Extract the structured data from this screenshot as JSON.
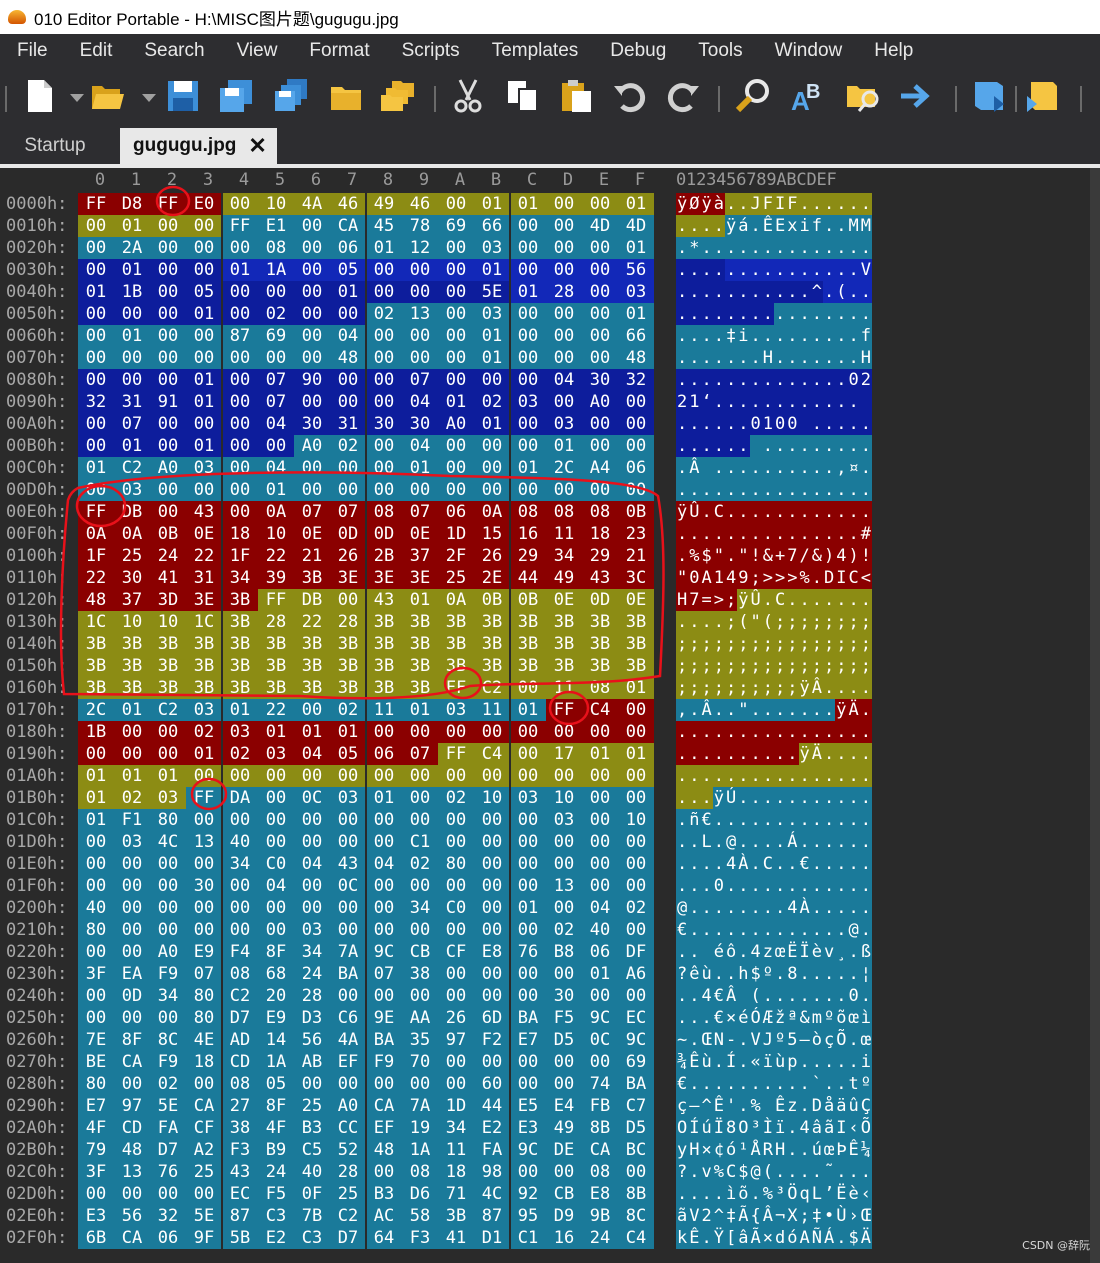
{
  "title_bar": {
    "title": "010 Editor Portable - H:\\MISC图片题\\gugugu.jpg"
  },
  "menu": [
    "File",
    "Edit",
    "Search",
    "View",
    "Format",
    "Scripts",
    "Templates",
    "Debug",
    "Tools",
    "Window",
    "Help"
  ],
  "toolbar": {
    "icons": [
      "new-file-icon",
      "open-file-icon",
      "save-icon",
      "save-as-icon",
      "save-all-icon",
      "open-folder-icon",
      "multi-folder-icon",
      "cut-icon",
      "copy-icon",
      "paste-icon",
      "undo-icon",
      "redo-icon",
      "find-icon",
      "replace-icon",
      "find-in-files-icon",
      "goto-icon",
      "run-script-icon",
      "run-template-icon"
    ]
  },
  "tabs": {
    "startup": "Startup",
    "active": "gugugu.jpg",
    "close": "✕"
  },
  "hex": {
    "columns": [
      "0",
      "1",
      "2",
      "3",
      "4",
      "5",
      "6",
      "7",
      "8",
      "9",
      "A",
      "B",
      "C",
      "D",
      "E",
      "F"
    ],
    "ascii_header": "0123456789ABCDEF",
    "colors": {
      "dark_red": "#8b0000",
      "olive": "#8c8c14",
      "teal": "#1a7a9a",
      "navy": "#0d1d9c",
      "bright_navy": "#1228b8",
      "marker": "#e8111a"
    },
    "rows": [
      {
        "addr": "0000h:",
        "bytes": "FF D8 FF E0 00 10 4A 46 49 46 00 01 01 00 00 01",
        "ascii": "ÿØÿà..JFIF......"
      },
      {
        "addr": "0010h:",
        "bytes": "00 01 00 00 FF E1 00 CA 45 78 69 66 00 00 4D 4D",
        "ascii": "....ÿá.ÊExif..MM"
      },
      {
        "addr": "0020h:",
        "bytes": "00 2A 00 00 00 08 00 06 01 12 00 03 00 00 00 01",
        "ascii": ".*.............."
      },
      {
        "addr": "0030h:",
        "bytes": "00 01 00 00 01 1A 00 05 00 00 00 01 00 00 00 56",
        "ascii": "...............V"
      },
      {
        "addr": "0040h:",
        "bytes": "01 1B 00 05 00 00 00 01 00 00 00 5E 01 28 00 03",
        "ascii": "...........^.(.."
      },
      {
        "addr": "0050h:",
        "bytes": "00 00 00 01 00 02 00 00 02 13 00 03 00 00 00 01",
        "ascii": "................"
      },
      {
        "addr": "0060h:",
        "bytes": "00 01 00 00 87 69 00 04 00 00 00 01 00 00 00 66",
        "ascii": "....‡i.........f"
      },
      {
        "addr": "0070h:",
        "bytes": "00 00 00 00 00 00 00 48 00 00 00 01 00 00 00 48",
        "ascii": ".......H.......H"
      },
      {
        "addr": "0080h:",
        "bytes": "00 00 00 01 00 07 90 00 00 07 00 00 00 04 30 32",
        "ascii": "..............02"
      },
      {
        "addr": "0090h:",
        "bytes": "32 31 91 01 00 07 00 00 00 04 01 02 03 00 A0 00",
        "ascii": "21‘............ "
      },
      {
        "addr": "00A0h:",
        "bytes": "00 07 00 00 00 04 30 31 30 30 A0 01 00 03 00 00",
        "ascii": "......0100 ....."
      },
      {
        "addr": "00B0h:",
        "bytes": "00 01 00 01 00 00 A0 02 00 04 00 00 00 01 00 00",
        "ascii": "...... ........."
      },
      {
        "addr": "00C0h:",
        "bytes": "01 C2 A0 03 00 04 00 00 00 01 00 00 01 2C A4 06",
        "ascii": ".Â ..........,¤."
      },
      {
        "addr": "00D0h:",
        "bytes": "00 03 00 00 00 01 00 00 00 00 00 00 00 00 00 00",
        "ascii": "................"
      },
      {
        "addr": "00E0h:",
        "bytes": "FF DB 00 43 00 0A 07 07 08 07 06 0A 08 08 08 0B",
        "ascii": "ÿÛ.C............"
      },
      {
        "addr": "00F0h:",
        "bytes": "0A 0A 0B 0E 18 10 0E 0D 0D 0E 1D 15 16 11 18 23",
        "ascii": "...............#"
      },
      {
        "addr": "0100h:",
        "bytes": "1F 25 24 22 1F 22 21 26 2B 37 2F 26 29 34 29 21",
        "ascii": ".%$\".\"!&+7/&)4)!"
      },
      {
        "addr": "0110h:",
        "bytes": "22 30 41 31 34 39 3B 3E 3E 3E 25 2E 44 49 43 3C",
        "ascii": "\"0A149;>>>%.DIC<"
      },
      {
        "addr": "0120h:",
        "bytes": "48 37 3D 3E 3B FF DB 00 43 01 0A 0B 0B 0E 0D 0E",
        "ascii": "H7=>;ÿÛ.C......."
      },
      {
        "addr": "0130h:",
        "bytes": "1C 10 10 1C 3B 28 22 28 3B 3B 3B 3B 3B 3B 3B 3B",
        "ascii": "....;(\"(;;;;;;;;"
      },
      {
        "addr": "0140h:",
        "bytes": "3B 3B 3B 3B 3B 3B 3B 3B 3B 3B 3B 3B 3B 3B 3B 3B",
        "ascii": ";;;;;;;;;;;;;;;;"
      },
      {
        "addr": "0150h:",
        "bytes": "3B 3B 3B 3B 3B 3B 3B 3B 3B 3B 3B 3B 3B 3B 3B 3B",
        "ascii": ";;;;;;;;;;;;;;;;"
      },
      {
        "addr": "0160h:",
        "bytes": "3B 3B 3B 3B 3B 3B 3B 3B 3B 3B FF C2 00 11 08 01",
        "ascii": ";;;;;;;;;;ÿÂ...."
      },
      {
        "addr": "0170h:",
        "bytes": "2C 01 C2 03 01 22 00 02 11 01 03 11 01 FF C4 00",
        "ascii": ",.Â..\".......ÿÄ."
      },
      {
        "addr": "0180h:",
        "bytes": "1B 00 00 02 03 01 01 01 00 00 00 00 00 00 00 00",
        "ascii": "................"
      },
      {
        "addr": "0190h:",
        "bytes": "00 00 00 01 02 03 04 05 06 07 FF C4 00 17 01 01",
        "ascii": "..........ÿÄ...."
      },
      {
        "addr": "01A0h:",
        "bytes": "01 01 01 00 00 00 00 00 00 00 00 00 00 00 00 00",
        "ascii": "................"
      },
      {
        "addr": "01B0h:",
        "bytes": "01 02 03 FF DA 00 0C 03 01 00 02 10 03 10 00 00",
        "ascii": "...ÿÚ.........."
      },
      {
        "addr": "01C0h:",
        "bytes": "01 F1 80 00 00 00 00 00 00 00 00 00 00 03 00 10",
        "ascii": ".ñ€............."
      },
      {
        "addr": "01D0h:",
        "bytes": "00 03 4C 13 40 00 00 00 00 C1 00 00 00 00 00 00",
        "ascii": "..L.@....Á......"
      },
      {
        "addr": "01E0h:",
        "bytes": "00 00 00 00 34 C0 04 43 04 02 80 00 00 00 00 00",
        "ascii": "....4À.C..€....."
      },
      {
        "addr": "01F0h:",
        "bytes": "00 00 00 30 00 04 00 0C 00 00 00 00 00 13 00 00",
        "ascii": "...0............"
      },
      {
        "addr": "0200h:",
        "bytes": "40 00 00 00 00 00 00 00 00 34 C0 00 01 00 04 02",
        "ascii": "@........4À....."
      },
      {
        "addr": "0210h:",
        "bytes": "80 00 00 00 00 00 03 00 00 00 00 00 00 02 40 00",
        "ascii": "€.............@."
      },
      {
        "addr": "0220h:",
        "bytes": "00 00 A0 E9 F4 8F 34 7A 9C CB CF E8 76 B8 06 DF",
        "ascii": ".. éô.4zœËÏèv¸.ß"
      },
      {
        "addr": "0230h:",
        "bytes": "3F EA F9 07 08 68 24 BA 07 38 00 00 00 00 01 A6",
        "ascii": "?êù..h$º.8.....¦"
      },
      {
        "addr": "0240h:",
        "bytes": "00 0D 34 80 C2 20 28 00 00 00 00 00 00 30 00 00",
        "ascii": "..4€Â (.......0."
      },
      {
        "addr": "0250h:",
        "bytes": "00 00 00 80 D7 E9 D3 C6 9E AA 26 6D BA F5 9C EC",
        "ascii": "...€×éÓÆžª&mºõœì"
      },
      {
        "addr": "0260h:",
        "bytes": "7E 8F 8C 4E AD 14 56 4A BA 35 97 F2 E7 D5 0C 9C",
        "ascii": "~.ŒN-.VJº5—òçÕ.œ"
      },
      {
        "addr": "0270h:",
        "bytes": "BE CA F9 18 CD 1A AB EF F9 70 00 00 00 00 00 69",
        "ascii": "¾Êù.Í.«ïùp.....i"
      },
      {
        "addr": "0280h:",
        "bytes": "80 00 02 00 08 05 00 00 00 00 00 60 00 00 74 BA",
        "ascii": "€..........`..tº"
      },
      {
        "addr": "0290h:",
        "bytes": "E7 97 5E CA 27 8F 25 A0 CA 7A 1D 44 E5 E4 FB C7",
        "ascii": "ç—^Ê'.% Êz.DåäûÇ"
      },
      {
        "addr": "02A0h:",
        "bytes": "4F CD FA CF 38 4F B3 CC EF 19 34 E2 E3 49 8B D5",
        "ascii": "OÍúÏ8O³Ìï.4âãI‹Õ"
      },
      {
        "addr": "02B0h:",
        "bytes": "79 48 D7 A2 F3 B9 C5 52 48 1A 11 FA 9C DE CA BC",
        "ascii": "yH×¢ó¹ÅRH..úœÞÊ¼"
      },
      {
        "addr": "02C0h:",
        "bytes": "3F 13 76 25 43 24 40 28 00 08 18 98 00 00 08 00",
        "ascii": "?.v%C$@(....˜...."
      },
      {
        "addr": "02D0h:",
        "bytes": "00 00 00 00 EC F5 0F 25 B3 D6 71 4C 92 CB E8 8B",
        "ascii": "....ìõ.%³ÖqL’Ëè‹"
      },
      {
        "addr": "02E0h:",
        "bytes": "E3 56 32 5E 87 C3 7B C2 AC 58 3B 87 95 D9 9B 8C",
        "ascii": "ãV2^‡Ã{Â¬X;‡•Ù›Œ"
      },
      {
        "addr": "02F0h:",
        "bytes": "6B CA 06 9F 5B E2 C3 D7 64 F3 41 D1 C1 16 24 C4",
        "ascii": "kÊ.Ÿ[âÃ×dóAÑÁ.$Ä"
      }
    ]
  },
  "watermark": "CSDN @辞阮"
}
